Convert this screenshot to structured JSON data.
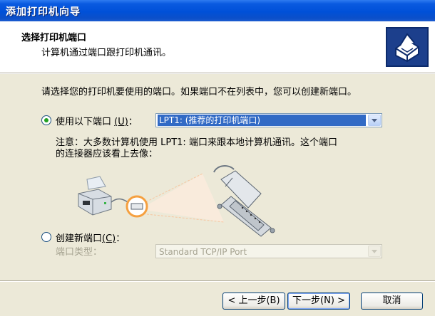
{
  "window": {
    "title": "添加打印机向导"
  },
  "header": {
    "title": "选择打印机端口",
    "subtitle": "计算机通过端口跟打印机通讯。",
    "icon": "printer-wizard-icon"
  },
  "body": {
    "instruction": "请选择您的打印机要使用的端口。如果端口不在列表中，您可以创建新端口。",
    "use_port": {
      "label": "使用以下端口",
      "shortcut": "(U)",
      "colon": "：",
      "selected": true,
      "value": "LPT1: (推荐的打印机端口)"
    },
    "note_line1": "注意：大多数计算机使用 LPT1: 端口来跟本地计算机通讯。这个端口",
    "note_line2": "的连接器应该看上去像：",
    "new_port": {
      "label": "创建新端口",
      "shortcut": "(C)",
      "colon": "：",
      "selected": false,
      "type_label": "端口类型：",
      "type_value": "Standard TCP/IP Port"
    }
  },
  "buttons": {
    "back": "< 上一步(B)",
    "next": "下一步(N) >",
    "cancel": "取消"
  },
  "colors": {
    "titlebar": "#0050D8",
    "dialog_bg": "#ECE9D8",
    "selection": "#316AC5",
    "highlight_ring": "#F5A040"
  }
}
